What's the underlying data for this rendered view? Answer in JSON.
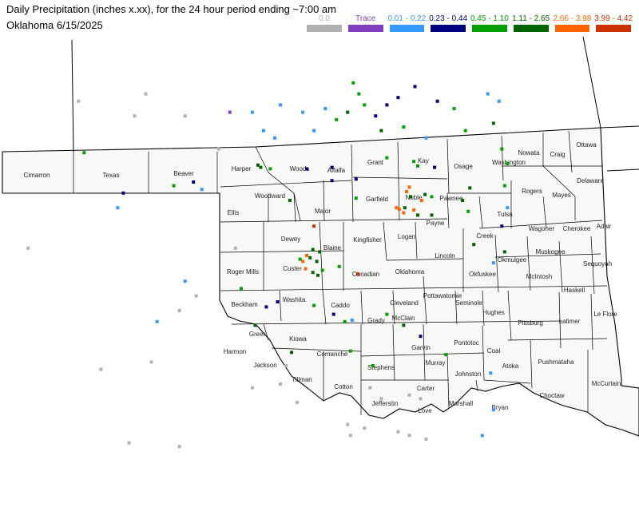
{
  "header": {
    "title": "Daily Precipitation (inches  x.xx),  for the 24 hour period ending ~7:00 am",
    "subtitle": "Oklahoma 6/15/2025"
  },
  "legend": [
    {
      "label": "0.0",
      "color": "#b0b0b0"
    },
    {
      "label": "Trace",
      "color": "#8040c0"
    },
    {
      "label": "0.01 - 0.22",
      "color": "#3399ff"
    },
    {
      "label": "0.23 - 0.44",
      "color": "#000080"
    },
    {
      "label": "0.45 - 1.10",
      "color": "#00a000"
    },
    {
      "label": "1.11 - 2.65",
      "color": "#006400"
    },
    {
      "label": "2.66 - 3.98",
      "color": "#ff6600"
    },
    {
      "label": "3.99 - 4.42",
      "color": "#cc3300"
    }
  ],
  "colors": {
    "map_fill": "#f8f8f6",
    "border": "#000000",
    "background": "#ffffff"
  },
  "counties": [
    {
      "name": "Cimarron"
    },
    {
      "name": "Texas"
    },
    {
      "name": "Beaver"
    },
    {
      "name": "Harper"
    },
    {
      "name": "Woods"
    },
    {
      "name": "Alfalfa"
    },
    {
      "name": "Grant"
    },
    {
      "name": "Kay"
    },
    {
      "name": "Osage"
    },
    {
      "name": "Washington"
    },
    {
      "name": "Nowata"
    },
    {
      "name": "Craig"
    },
    {
      "name": "Ottawa"
    },
    {
      "name": "Delaware"
    },
    {
      "name": "Rogers"
    },
    {
      "name": "Mayes"
    },
    {
      "name": "Woodward"
    },
    {
      "name": "Major"
    },
    {
      "name": "Garfield"
    },
    {
      "name": "Noble"
    },
    {
      "name": "Pawnee"
    },
    {
      "name": "Ellis"
    },
    {
      "name": "Tulsa"
    },
    {
      "name": "Wagoner"
    },
    {
      "name": "Cherokee"
    },
    {
      "name": "Adair"
    },
    {
      "name": "Payne"
    },
    {
      "name": "Logan"
    },
    {
      "name": "Kingfisher"
    },
    {
      "name": "Blaine"
    },
    {
      "name": "Dewey"
    },
    {
      "name": "Creek"
    },
    {
      "name": "Lincoln"
    },
    {
      "name": "Okmulgee"
    },
    {
      "name": "Muskogee"
    },
    {
      "name": "Sequoyah"
    },
    {
      "name": "Roger Mills"
    },
    {
      "name": "Custer"
    },
    {
      "name": "Canadian"
    },
    {
      "name": "Oklahoma"
    },
    {
      "name": "Okfuskee"
    },
    {
      "name": "McIntosh"
    },
    {
      "name": "Beckham"
    },
    {
      "name": "Washita"
    },
    {
      "name": "Caddo"
    },
    {
      "name": "Cleveland"
    },
    {
      "name": "Pottawatomie"
    },
    {
      "name": "Seminole"
    },
    {
      "name": "Haskell"
    },
    {
      "name": "Hughes"
    },
    {
      "name": "Le Flore"
    },
    {
      "name": "Grady"
    },
    {
      "name": "McClain"
    },
    {
      "name": "Pittsburg"
    },
    {
      "name": "Latimer"
    },
    {
      "name": "Greer"
    },
    {
      "name": "Kiowa"
    },
    {
      "name": "Harmon"
    },
    {
      "name": "Garvin"
    },
    {
      "name": "Pontotoc"
    },
    {
      "name": "Coal"
    },
    {
      "name": "Jackson"
    },
    {
      "name": "Comanche"
    },
    {
      "name": "Stephens"
    },
    {
      "name": "Murray"
    },
    {
      "name": "Atoka"
    },
    {
      "name": "Pushmataha"
    },
    {
      "name": "Johnston"
    },
    {
      "name": "Tillman"
    },
    {
      "name": "Cotton"
    },
    {
      "name": "Carter"
    },
    {
      "name": "McCurtain"
    },
    {
      "name": "Choctaw"
    },
    {
      "name": "Jefferson"
    },
    {
      "name": "Marshall"
    },
    {
      "name": "Love"
    },
    {
      "name": "Bryan"
    }
  ],
  "stations": [
    {
      "lon": -98.4,
      "lat": 36.73,
      "cat": 6
    },
    {
      "lon": -98.35,
      "lat": 36.7,
      "cat": 6
    },
    {
      "lon": -98.18,
      "lat": 36.68,
      "cat": 5
    },
    {
      "lon": -97.53,
      "lat": 36.68,
      "cat": 4
    },
    {
      "lon": -97.08,
      "lat": 36.7,
      "cat": 4
    },
    {
      "lon": -96.1,
      "lat": 36.83,
      "cat": 5
    },
    {
      "lon": -95.62,
      "lat": 36.78,
      "cat": 5
    },
    {
      "lon": -95.55,
      "lat": 36.72,
      "cat": 5
    },
    {
      "lon": -95.25,
      "lat": 36.7,
      "cat": 4
    },
    {
      "lon": -96.65,
      "lat": 36.54,
      "cat": 4
    },
    {
      "lon": -97.83,
      "lat": 36.25,
      "cat": 6
    },
    {
      "lon": -97.08,
      "lat": 36.52,
      "cat": 4
    },
    {
      "lon": -96.65,
      "lat": 36.28,
      "cat": 5
    },
    {
      "lon": -95.7,
      "lat": 36.43,
      "cat": 7
    },
    {
      "lon": -95.75,
      "lat": 36.37,
      "cat": 7
    },
    {
      "lon": -95.68,
      "lat": 36.3,
      "cat": 6
    },
    {
      "lon": -95.42,
      "lat": 36.33,
      "cat": 6
    },
    {
      "lon": -95.3,
      "lat": 36.3,
      "cat": 5
    },
    {
      "lon": -95.48,
      "lat": 36.25,
      "cat": 7
    },
    {
      "lon": -95.93,
      "lat": 36.15,
      "cat": 7
    },
    {
      "lon": -95.88,
      "lat": 36.13,
      "cat": 7
    },
    {
      "lon": -95.8,
      "lat": 36.08,
      "cat": 7
    },
    {
      "lon": -95.78,
      "lat": 36.15,
      "cat": 6
    },
    {
      "lon": -95.62,
      "lat": 36.12,
      "cat": 7
    },
    {
      "lon": -95.55,
      "lat": 36.05,
      "cat": 6
    },
    {
      "lon": -95.3,
      "lat": 36.05,
      "cat": 6
    },
    {
      "lon": -94.75,
      "lat": 36.25,
      "cat": 6
    },
    {
      "lon": -94.62,
      "lat": 36.42,
      "cat": 6
    },
    {
      "lon": -94.65,
      "lat": 36.1,
      "cat": 5
    },
    {
      "lon": -94.55,
      "lat": 35.65,
      "cat": 6
    },
    {
      "lon": -97.3,
      "lat": 35.55,
      "cat": 6
    },
    {
      "lon": -97.42,
      "lat": 35.58,
      "cat": 6
    },
    {
      "lon": -97.53,
      "lat": 35.5,
      "cat": 7
    },
    {
      "lon": -97.47,
      "lat": 35.47,
      "cat": 6
    },
    {
      "lon": -97.6,
      "lat": 35.42,
      "cat": 7
    },
    {
      "lon": -97.35,
      "lat": 35.42,
      "cat": 6
    },
    {
      "lon": -97.55,
      "lat": 35.32,
      "cat": 7
    },
    {
      "lon": -97.65,
      "lat": 35.45,
      "cat": 5
    },
    {
      "lon": -97.42,
      "lat": 35.27,
      "cat": 6
    },
    {
      "lon": -97.33,
      "lat": 35.23,
      "cat": 6
    },
    {
      "lon": -97.25,
      "lat": 35.3,
      "cat": 5
    },
    {
      "lon": -96.95,
      "lat": 35.35,
      "cat": 5
    },
    {
      "lon": -97.4,
      "lat": 35.9,
      "cat": 8
    },
    {
      "lon": -96.62,
      "lat": 35.25,
      "cat": 8
    },
    {
      "lon": -98.7,
      "lat": 35.05,
      "cat": 5
    },
    {
      "lon": -98.25,
      "lat": 34.8,
      "cat": 4
    },
    {
      "lon": -98.05,
      "lat": 34.87,
      "cat": 4
    },
    {
      "lon": -98.45,
      "lat": 34.55,
      "cat": 6
    },
    {
      "lon": -97.4,
      "lat": 34.82,
      "cat": 5
    },
    {
      "lon": -97.05,
      "lat": 34.7,
      "cat": 4
    },
    {
      "lon": -96.85,
      "lat": 34.6,
      "cat": 5
    },
    {
      "lon": -96.72,
      "lat": 34.62,
      "cat": 3
    },
    {
      "lon": -96.1,
      "lat": 34.7,
      "cat": 5
    },
    {
      "lon": -95.8,
      "lat": 34.55,
      "cat": 6
    },
    {
      "lon": -95.5,
      "lat": 34.4,
      "cat": 4
    },
    {
      "lon": -95.05,
      "lat": 34.15,
      "cat": 5
    },
    {
      "lon": -96.75,
      "lat": 34.2,
      "cat": 5
    },
    {
      "lon": -97.8,
      "lat": 34.18,
      "cat": 6
    },
    {
      "lon": -96.35,
      "lat": 34.0,
      "cat": 5
    },
    {
      "lon": -99.9,
      "lat": 36.45,
      "cat": 5
    },
    {
      "lon": -99.55,
      "lat": 36.5,
      "cat": 4
    },
    {
      "lon": -99.4,
      "lat": 36.4,
      "cat": 3
    },
    {
      "lon": -101.5,
      "lat": 36.9,
      "cat": 5
    },
    {
      "lon": -100.8,
      "lat": 36.35,
      "cat": 4
    },
    {
      "lon": -100.9,
      "lat": 36.15,
      "cat": 3
    },
    {
      "lon": -99.7,
      "lat": 35.15,
      "cat": 3
    },
    {
      "lon": -99.5,
      "lat": 34.95,
      "cat": 1
    },
    {
      "lon": -99.8,
      "lat": 34.75,
      "cat": 1
    },
    {
      "lon": -99.1,
      "lat": 36.95,
      "cat": 1
    },
    {
      "lon": -98.8,
      "lat": 35.6,
      "cat": 1
    },
    {
      "lon": -97.9,
      "lat": 34.0,
      "cat": 1
    },
    {
      "lon": -96.4,
      "lat": 33.7,
      "cat": 1
    },
    {
      "lon": -96.2,
      "lat": 33.55,
      "cat": 1
    },
    {
      "lon": -96.0,
      "lat": 33.5,
      "cat": 1
    },
    {
      "lon": -95.7,
      "lat": 33.6,
      "cat": 1
    },
    {
      "lon": -95.5,
      "lat": 33.55,
      "cat": 1
    },
    {
      "lon": -96.8,
      "lat": 33.2,
      "cat": 1
    },
    {
      "lon": -96.75,
      "lat": 33.05,
      "cat": 1
    },
    {
      "lon": -96.5,
      "lat": 33.15,
      "cat": 1
    },
    {
      "lon": -95.9,
      "lat": 33.1,
      "cat": 1
    },
    {
      "lon": -95.7,
      "lat": 33.05,
      "cat": 1
    },
    {
      "lon": -95.4,
      "lat": 33.0,
      "cat": 1
    },
    {
      "lon": -100.3,
      "lat": 34.05,
      "cat": 1
    },
    {
      "lon": -101.2,
      "lat": 33.95,
      "cat": 1
    },
    {
      "lon": -100.7,
      "lat": 32.95,
      "cat": 1
    },
    {
      "lon": -99.8,
      "lat": 32.9,
      "cat": 1
    },
    {
      "lon": -98.5,
      "lat": 33.7,
      "cat": 1
    },
    {
      "lon": -98.0,
      "lat": 33.75,
      "cat": 1
    },
    {
      "lon": -97.7,
      "lat": 33.5,
      "cat": 1
    },
    {
      "lon": -99.7,
      "lat": 37.4,
      "cat": 1
    },
    {
      "lon": -100.4,
      "lat": 37.7,
      "cat": 1
    },
    {
      "lon": -100.6,
      "lat": 37.4,
      "cat": 1
    },
    {
      "lon": -101.6,
      "lat": 37.6,
      "cat": 1
    },
    {
      "lon": -102.5,
      "lat": 35.6,
      "cat": 1
    },
    {
      "lon": -96.1,
      "lat": 37.55,
      "cat": 4
    },
    {
      "lon": -96.3,
      "lat": 37.4,
      "cat": 4
    },
    {
      "lon": -95.9,
      "lat": 37.65,
      "cat": 4
    },
    {
      "lon": -95.6,
      "lat": 37.8,
      "cat": 4
    },
    {
      "lon": -95.2,
      "lat": 37.6,
      "cat": 4
    },
    {
      "lon": -96.6,
      "lat": 37.7,
      "cat": 5
    },
    {
      "lon": -96.7,
      "lat": 37.85,
      "cat": 5
    },
    {
      "lon": -96.5,
      "lat": 37.55,
      "cat": 5
    },
    {
      "lon": -96.8,
      "lat": 37.45,
      "cat": 6
    },
    {
      "lon": -97.0,
      "lat": 37.35,
      "cat": 5
    },
    {
      "lon": -96.2,
      "lat": 37.2,
      "cat": 6
    },
    {
      "lon": -95.8,
      "lat": 37.25,
      "cat": 5
    },
    {
      "lon": -95.4,
      "lat": 37.1,
      "cat": 3
    },
    {
      "lon": -94.9,
      "lat": 37.5,
      "cat": 5
    },
    {
      "lon": -94.7,
      "lat": 37.2,
      "cat": 5
    },
    {
      "lon": -94.2,
      "lat": 37.3,
      "cat": 6
    },
    {
      "lon": -94.3,
      "lat": 37.7,
      "cat": 3
    },
    {
      "lon": -94.1,
      "lat": 37.6,
      "cat": 3
    },
    {
      "lon": -97.6,
      "lat": 37.45,
      "cat": 3
    },
    {
      "lon": -97.4,
      "lat": 37.2,
      "cat": 3
    },
    {
      "lon": -97.2,
      "lat": 37.5,
      "cat": 3
    },
    {
      "lon": -98.0,
      "lat": 37.55,
      "cat": 3
    },
    {
      "lon": -98.5,
      "lat": 37.45,
      "cat": 3
    },
    {
      "lon": -98.9,
      "lat": 37.45,
      "cat": 2
    },
    {
      "lon": -98.3,
      "lat": 37.2,
      "cat": 3
    },
    {
      "lon": -98.1,
      "lat": 37.1,
      "cat": 3
    },
    {
      "lon": -94.05,
      "lat": 36.95,
      "cat": 5
    },
    {
      "lon": -93.95,
      "lat": 36.75,
      "cat": 5
    },
    {
      "lon": -94.0,
      "lat": 36.45,
      "cat": 5
    },
    {
      "lon": -93.95,
      "lat": 36.15,
      "cat": 3
    },
    {
      "lon": -94.05,
      "lat": 35.9,
      "cat": 4
    },
    {
      "lon": -94.0,
      "lat": 35.55,
      "cat": 6
    },
    {
      "lon": -94.2,
      "lat": 35.4,
      "cat": 3
    },
    {
      "lon": -94.25,
      "lat": 33.9,
      "cat": 3
    },
    {
      "lon": -94.2,
      "lat": 33.4,
      "cat": 3
    },
    {
      "lon": -94.4,
      "lat": 33.05,
      "cat": 3
    },
    {
      "lon": -100.2,
      "lat": 34.6,
      "cat": 3
    }
  ]
}
